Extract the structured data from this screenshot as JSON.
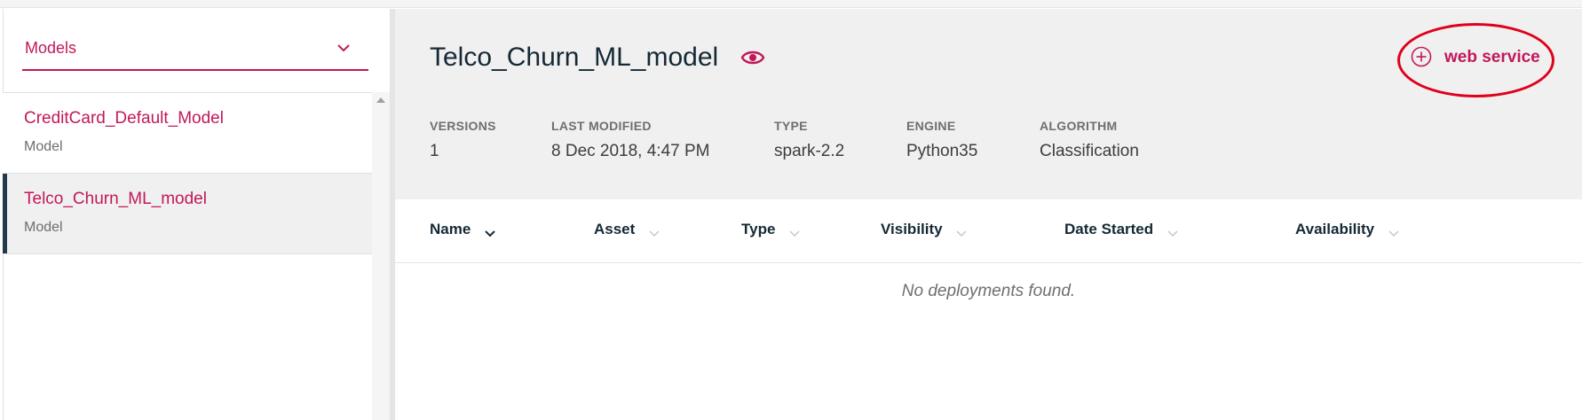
{
  "sidebar": {
    "dropdown_label": "Models",
    "items": [
      {
        "title": "CreditCard_Default_Model",
        "subtitle": "Model"
      },
      {
        "title": "Telco_Churn_ML_model",
        "subtitle": "Model"
      }
    ]
  },
  "header": {
    "title": "Telco_Churn_ML_model",
    "action_label": "web service",
    "meta": {
      "versions": {
        "label": "VERSIONS",
        "value": "1"
      },
      "last_modified": {
        "label": "LAST MODIFIED",
        "value": "8 Dec 2018, 4:47 PM"
      },
      "type": {
        "label": "TYPE",
        "value": "spark-2.2"
      },
      "engine": {
        "label": "ENGINE",
        "value": "Python35"
      },
      "algorithm": {
        "label": "ALGORITHM",
        "value": "Classification"
      }
    }
  },
  "table": {
    "columns": [
      "Name",
      "Asset",
      "Type",
      "Visibility",
      "Date Started",
      "Availability"
    ],
    "empty_message": "No deployments found."
  },
  "colors": {
    "accent": "#c2185b",
    "selected_bar": "#1f3b4d",
    "annotation_ring": "#e0001b"
  }
}
